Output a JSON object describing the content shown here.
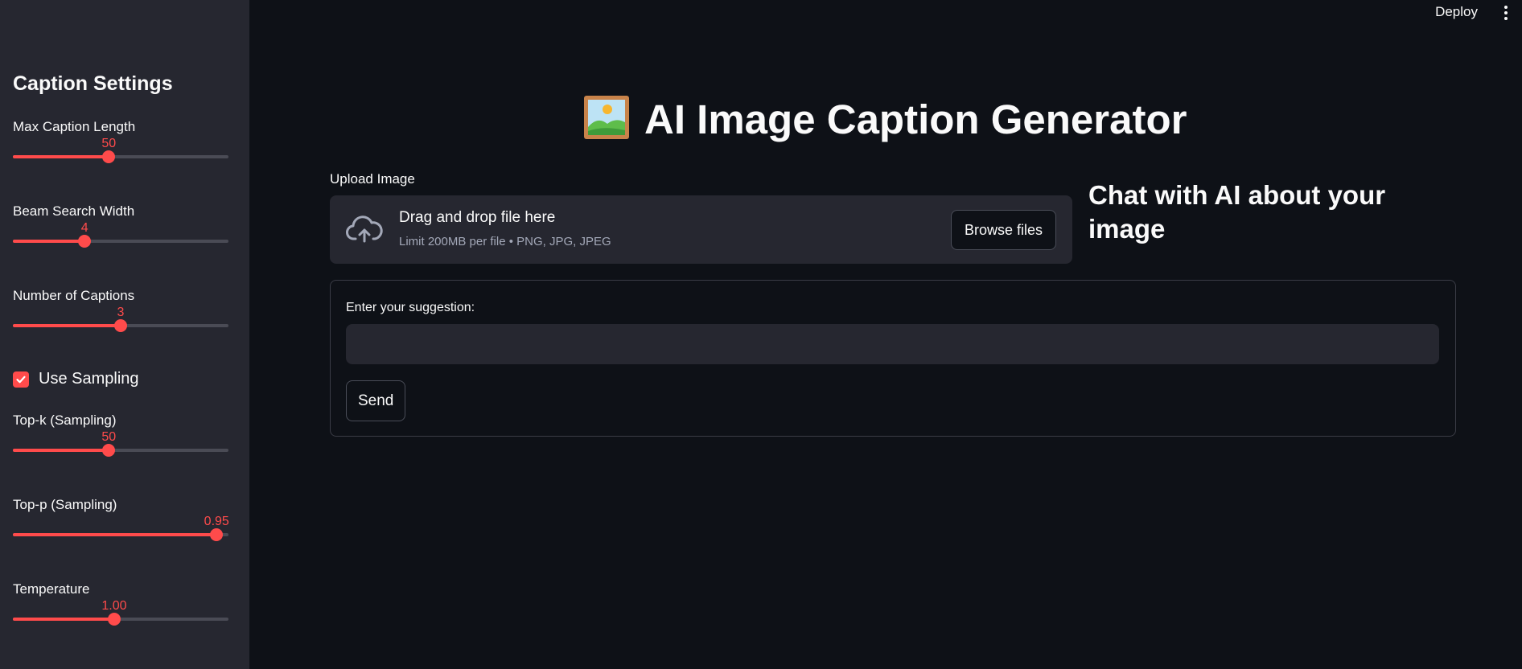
{
  "header": {
    "deploy_label": "Deploy"
  },
  "sidebar": {
    "title": "Caption Settings",
    "sliders": [
      {
        "label": "Max Caption Length",
        "value": "50",
        "fraction": 0.445
      },
      {
        "label": "Beam Search Width",
        "value": "4",
        "fraction": 0.333
      },
      {
        "label": "Number of Captions",
        "value": "3",
        "fraction": 0.5
      },
      {
        "label": "Top-k (Sampling)",
        "value": "50",
        "fraction": 0.445
      },
      {
        "label": "Top-p (Sampling)",
        "value": "0.95",
        "fraction": 0.945
      },
      {
        "label": "Temperature",
        "value": "1.00",
        "fraction": 0.47
      }
    ],
    "checkbox": {
      "label": "Use Sampling",
      "checked": true
    }
  },
  "main": {
    "title": "AI Image Caption Generator",
    "title_icon": "framed-picture-icon",
    "upload": {
      "label": "Upload Image",
      "drop_text": "Drag and drop file here",
      "limit_text": "Limit 200MB per file • PNG, JPG, JPEG",
      "browse_label": "Browse files"
    },
    "chat_title": "Chat with AI about your image",
    "form": {
      "label": "Enter your suggestion:",
      "input_value": "",
      "send_label": "Send"
    }
  },
  "colors": {
    "accent": "#ff4b4b",
    "background": "#0e1117",
    "sidebar": "#262730"
  }
}
